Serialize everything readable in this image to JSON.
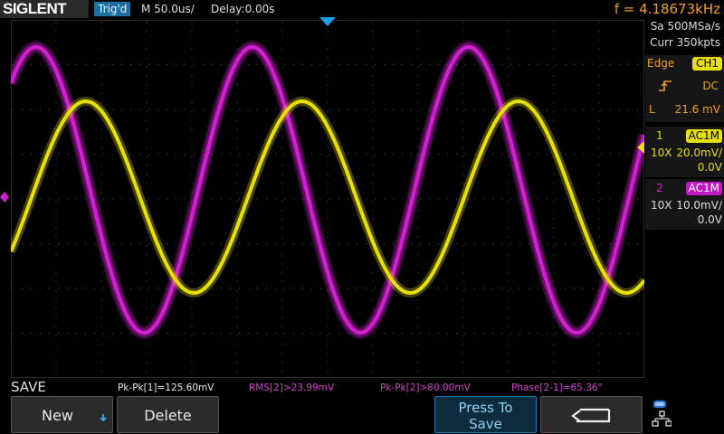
{
  "header": {
    "brand": "SIGLENT",
    "trigger_status": "Trig'd",
    "timebase": "M 50.0us/",
    "delay": "Delay:0.00s",
    "frequency": "f = 4.18673kHz"
  },
  "acquisition": {
    "sample_rate": "Sa 500MSa/s",
    "memory_depth": "Curr 350kpts"
  },
  "trigger": {
    "type": "Edge",
    "source": "CH1",
    "slope_icon": "rising-edge-icon",
    "coupling": "DC",
    "level_label": "L",
    "level": "21.6 mV"
  },
  "channels": [
    {
      "number": "1",
      "coupling": "AC1M",
      "probe": "10X",
      "scale": "20.0mV/",
      "offset": "0.0V",
      "color": "#e8e000"
    },
    {
      "number": "2",
      "coupling": "AC1M",
      "probe": "10X",
      "scale": "10.0mV/",
      "offset": "0.0V",
      "color": "#d020d0"
    }
  ],
  "measurements": [
    {
      "text": "Pk-Pk[1]=125.60mV",
      "color": "#e8e8e8"
    },
    {
      "text": "RMS[2]>23.99mV",
      "color": "#d040d0"
    },
    {
      "text": "Pk-Pk[2]>80.00mV",
      "color": "#d040d0"
    },
    {
      "text": "Phase[2-1]=65.36°",
      "color": "#d040d0"
    }
  ],
  "softkeys": {
    "menu_title": "SAVE",
    "new_label": "New",
    "delete_label": "Delete",
    "save_label_line1": "Press To",
    "save_label_line2": "Save",
    "back_icon": "return-arrow-icon",
    "network_icon": "network-usb-icon"
  }
}
